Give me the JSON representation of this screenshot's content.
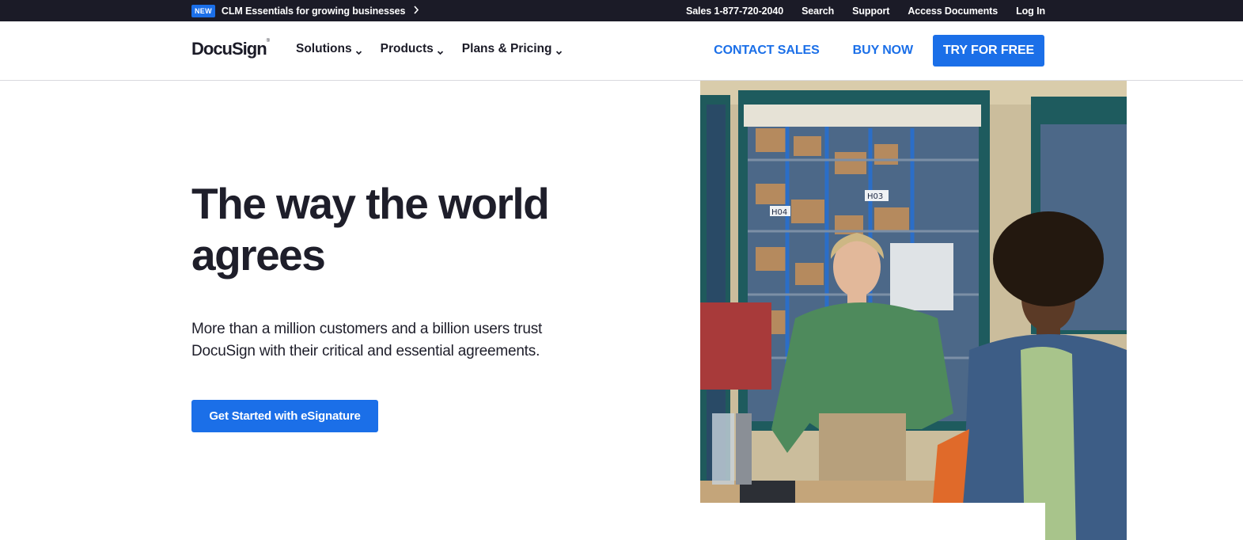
{
  "topbar": {
    "badge": "NEW",
    "promo_text": "CLM Essentials for growing businesses",
    "promo_chevron": "chevron-right-icon",
    "links": [
      "Sales 1-877-720-2040",
      "Search",
      "Support",
      "Access Documents",
      "Log In"
    ]
  },
  "nav": {
    "logo": "DocuSign",
    "menu": [
      {
        "label": "Solutions",
        "icon": "chevron-down-icon"
      },
      {
        "label": "Products",
        "icon": "chevron-down-icon"
      },
      {
        "label": "Plans & Pricing",
        "icon": "chevron-down-icon"
      }
    ],
    "contact_sales": "CONTACT SALES",
    "buy_now": "BUY NOW",
    "try_free": "TRY FOR FREE"
  },
  "hero": {
    "title": "The way the world agrees",
    "subtitle": "More than a million customers and a billion users trust DocuSign with their critical and essential agreements.",
    "cta": "Get Started with eSignature",
    "image": "two-women-warehouse-office-photo"
  },
  "photo_labels": [
    "H03",
    "H04"
  ],
  "colors": {
    "topbar_bg": "#1b1b27",
    "accent": "#1b6fe8",
    "text": "#1e1e2a"
  }
}
